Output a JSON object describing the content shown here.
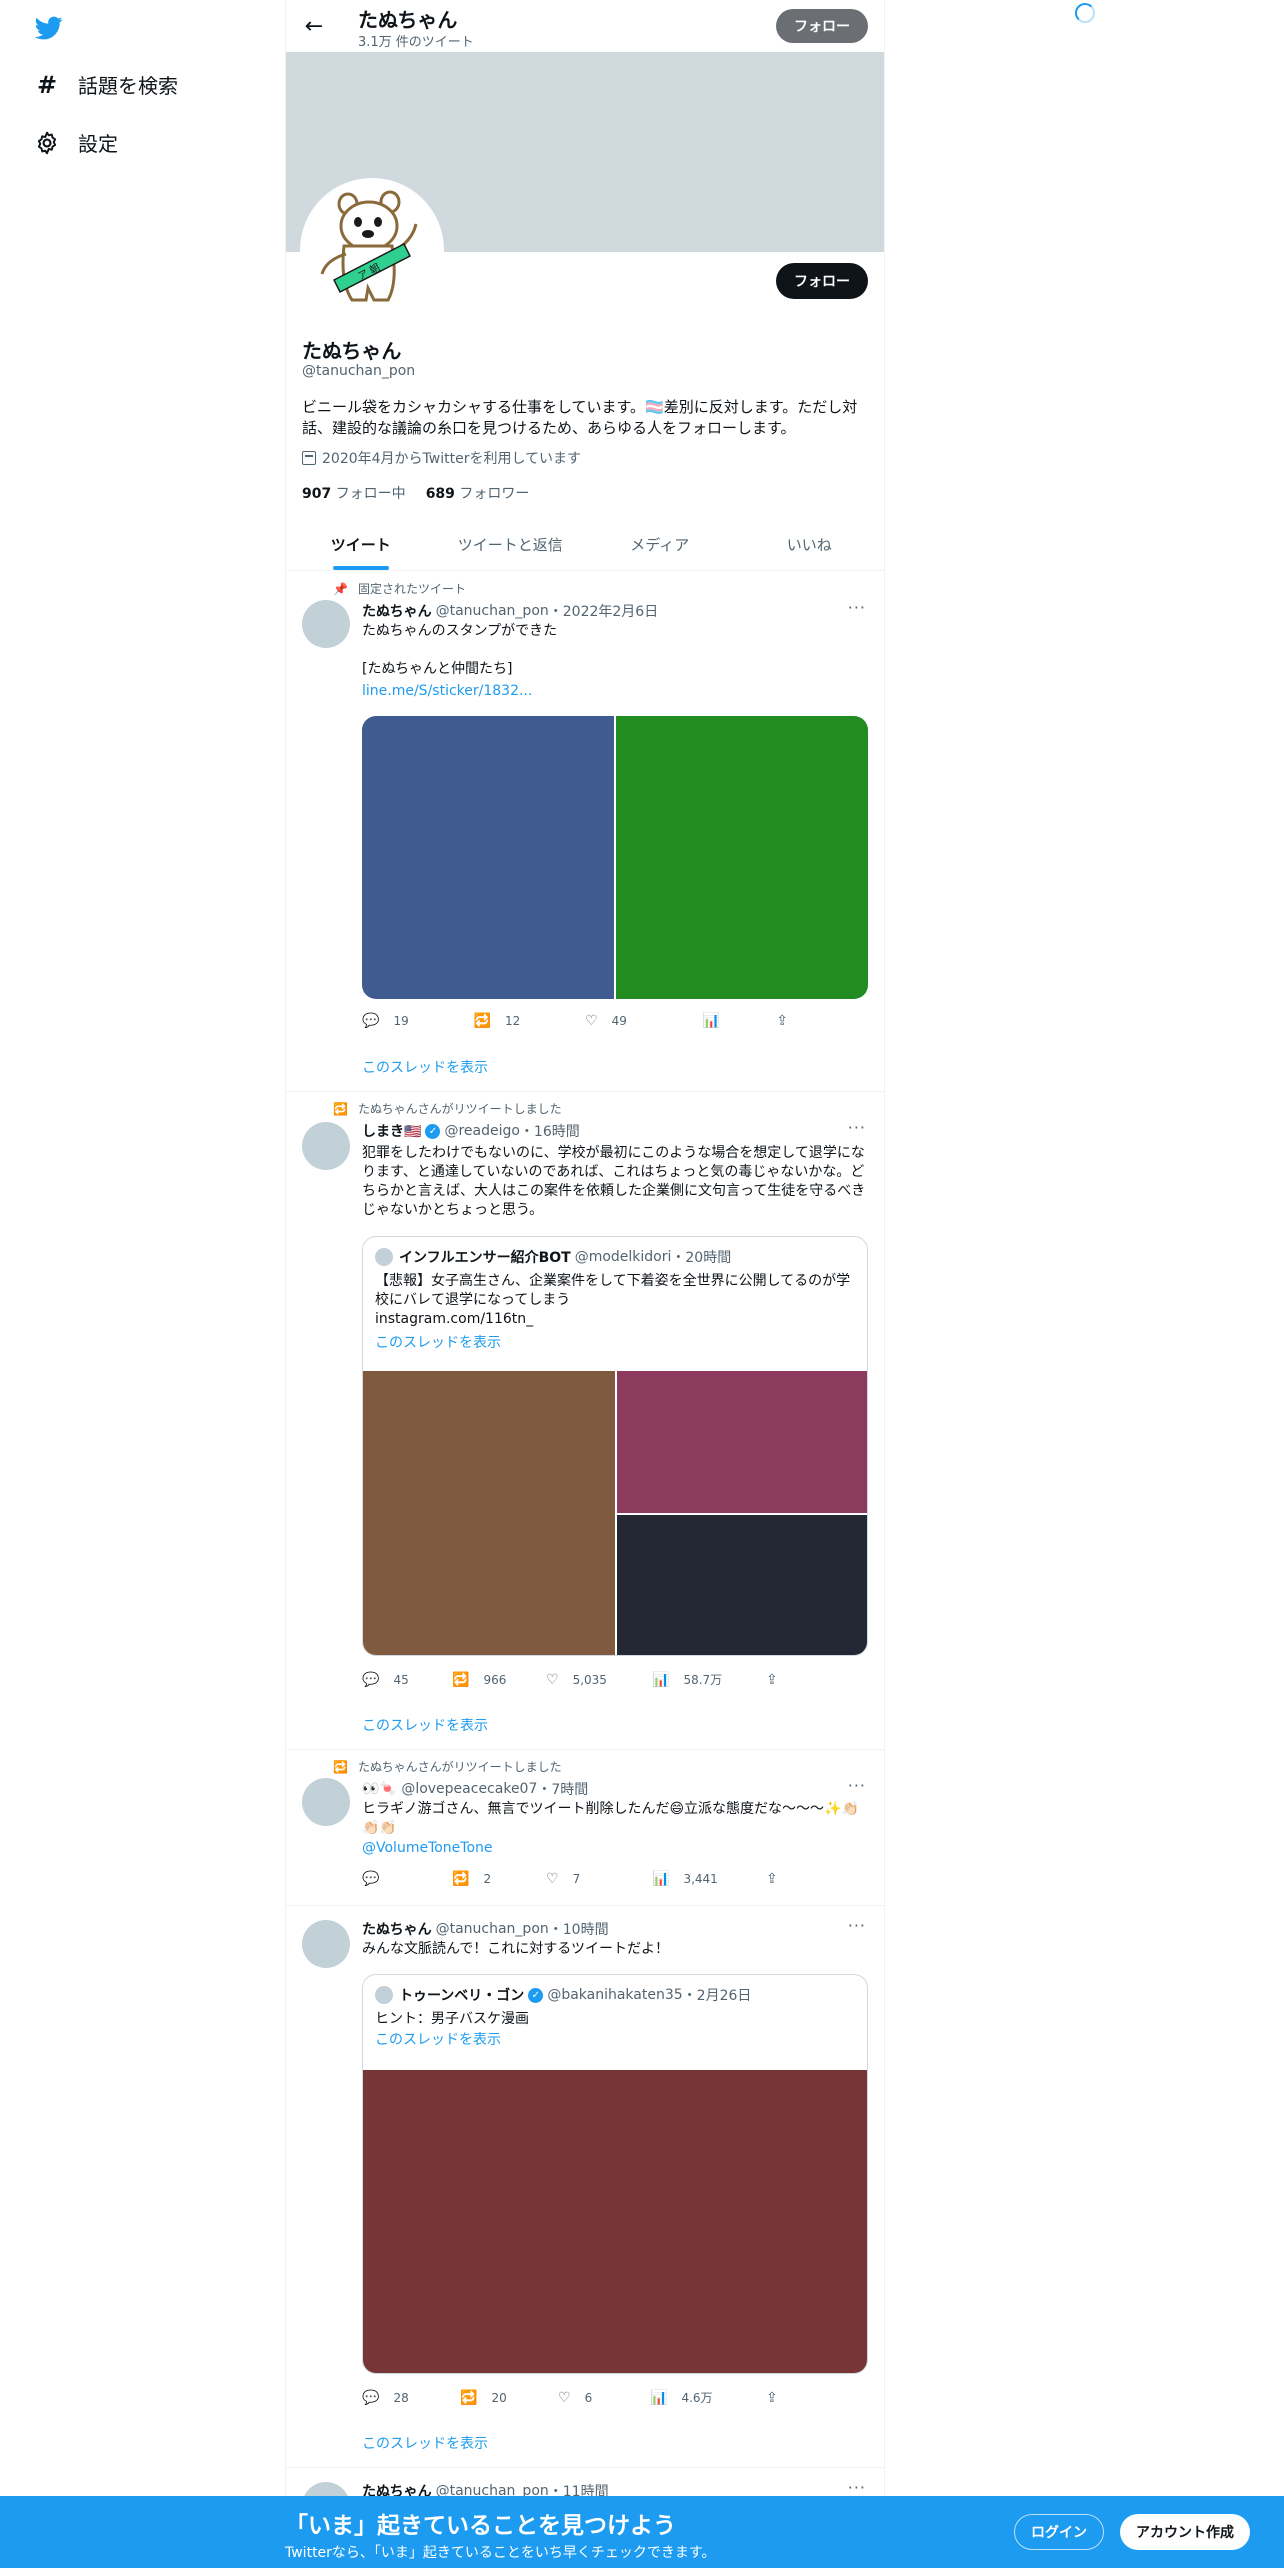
{
  "nav": {
    "logo_icon": "twitter-bird-icon",
    "items": [
      {
        "label": "話題を検索",
        "icon": "hashtag-icon"
      },
      {
        "label": "設定",
        "icon": "gear-icon"
      }
    ]
  },
  "header": {
    "name": "たぬちゃん",
    "tweet_count": "3.1万 件のツイート",
    "follow_label": "フォロー"
  },
  "profile": {
    "name": "たぬちゃん",
    "handle": "@tanuchan_pon",
    "follow_label": "フォロー",
    "bio": "ビニール袋をカシャカシャする仕事をしています。🏳️‍⚧️差別に反対します。ただし対話、建設的な議論の糸口を見つけるため、あらゆる人をフォローします。",
    "joined": "2020年4月からTwitterを利用しています",
    "following_count": "907",
    "following_label": "フォロー中",
    "followers_count": "689",
    "followers_label": "フォロワー",
    "avatar_sash_text": "ア 朝"
  },
  "tabs": [
    {
      "label": "ツイート",
      "active": true
    },
    {
      "label": "ツイートと返信",
      "active": false
    },
    {
      "label": "メディア",
      "active": false
    },
    {
      "label": "いいね",
      "active": false
    }
  ],
  "tweets": [
    {
      "context": "固定されたツイート",
      "name": "たぬちゃん",
      "handle": "@tanuchan_pon",
      "time": "・2022年2月6日",
      "text": "たぬちゃんのスタンプができた\n\n[たぬちゃんと仲間たち]",
      "link": "line.me/S/sticker/1832...",
      "media_colors": [
        "#3f5b8f",
        "#228b22"
      ],
      "replies": "19",
      "retweets": "12",
      "likes": "49",
      "views": "",
      "show_thread": "このスレッドを表示"
    },
    {
      "context": "たぬちゃんさんがリツイートしました",
      "name": "しまき🇺🇸",
      "handle": "@readeigo",
      "time": "・16時間",
      "text": "犯罪をしたわけでもないのに、学校が最初にこのような場合を想定して退学になります、と通達していないのであれば、これはちょっと気の毒じゃないかな。どちらかと言えば、大人はこの案件を依頼した企業側に文句言って生徒を守るべきじゃないかとちょっと思う。",
      "quote": {
        "name": "インフルエンサー紹介BOT",
        "handle": "@modelkidori",
        "time": "・20時間",
        "text": "【悲報】女子高生さん、企業案件をして下着姿を全世界に公開してるのが学校にバレて退学になってしまう\ninstagram.com/116tn_",
        "show_thread": "このスレッドを表示"
      },
      "media_colors": [
        "#7f5a3f",
        "#8c3a5e",
        "#232834"
      ],
      "replies": "45",
      "retweets": "966",
      "likes": "5,035",
      "views": "58.7万",
      "show_thread": "このスレッドを表示"
    },
    {
      "context": "たぬちゃんさんがリツイートしました",
      "name": "",
      "handle": "👀🍬 @lovepeacecake07",
      "time": "・7時間",
      "text": "ヒラギノ游ゴさん、無言でツイート削除したんだ😄立派な態度だな〜〜〜✨👏🏻👏🏻👏🏻",
      "link": "@VolumeToneTone",
      "replies": "",
      "retweets": "2",
      "likes": "7",
      "views": "3,441"
    },
    {
      "context": "",
      "name": "たぬちゃん",
      "handle": "@tanuchan_pon",
      "time": "・10時間",
      "text": "みんな文脈読んで！これに対するツイートだよ！",
      "quote": {
        "name": "トゥーンベリ・ゴン",
        "handle": "@bakanihakaten35",
        "time": "・2月26日",
        "text": "ヒント：男子バスケ漫画",
        "show_thread": "このスレッドを表示"
      },
      "media_colors": [
        "#763536"
      ],
      "replies": "28",
      "retweets": "20",
      "likes": "6",
      "views": "4.6万",
      "show_thread": "このスレッドを表示"
    },
    {
      "name": "たぬちゃん",
      "handle": "@tanuchan_pon",
      "time": "・11時間"
    }
  ],
  "bottom_bar": {
    "title": "「いま」起きていることを見つけよう",
    "subtitle": "Twitterなら、「いま」起きていることをいち早くチェックできます。",
    "login": "ログイン",
    "signup": "アカウント作成"
  },
  "colors": {
    "accent": "#1d9bf0",
    "text": "#0f1419",
    "secondary": "#536471",
    "banner": "#cfd9de"
  }
}
